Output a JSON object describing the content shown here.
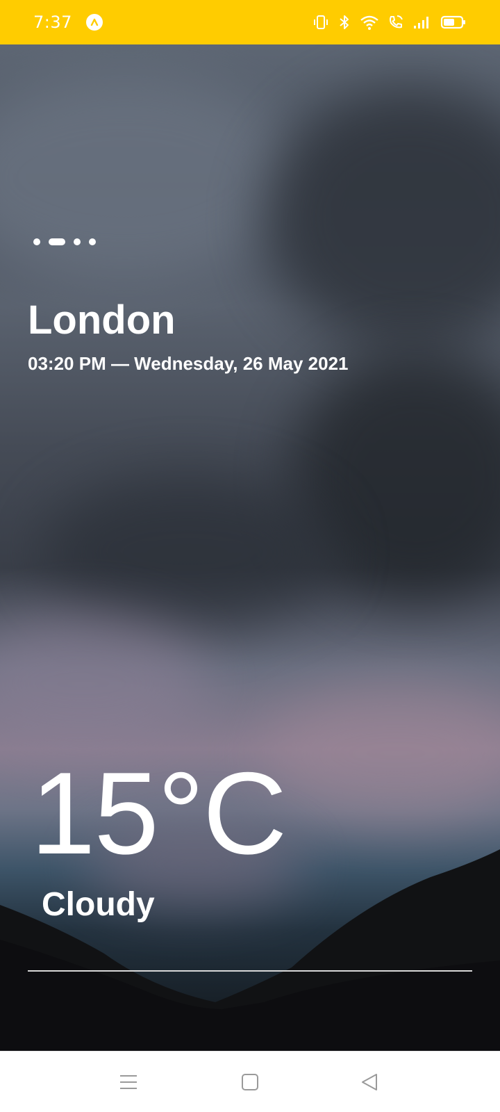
{
  "status_bar": {
    "time": "7:37",
    "background_color": "#ffcc00",
    "icons": [
      "app-icon",
      "vibrate-icon",
      "bluetooth-icon",
      "wifi-icon",
      "wifi-calling-icon",
      "signal-icon",
      "battery-icon"
    ]
  },
  "page_indicator": {
    "count": 4,
    "active_index": 1
  },
  "weather": {
    "city": "London",
    "datetime": "03:20 PM — Wednesday, 26 May 2021",
    "temperature": "15°C",
    "condition": "Cloudy"
  },
  "nav_bar": {
    "icons": [
      "menu-icon",
      "home-icon",
      "back-icon"
    ]
  }
}
